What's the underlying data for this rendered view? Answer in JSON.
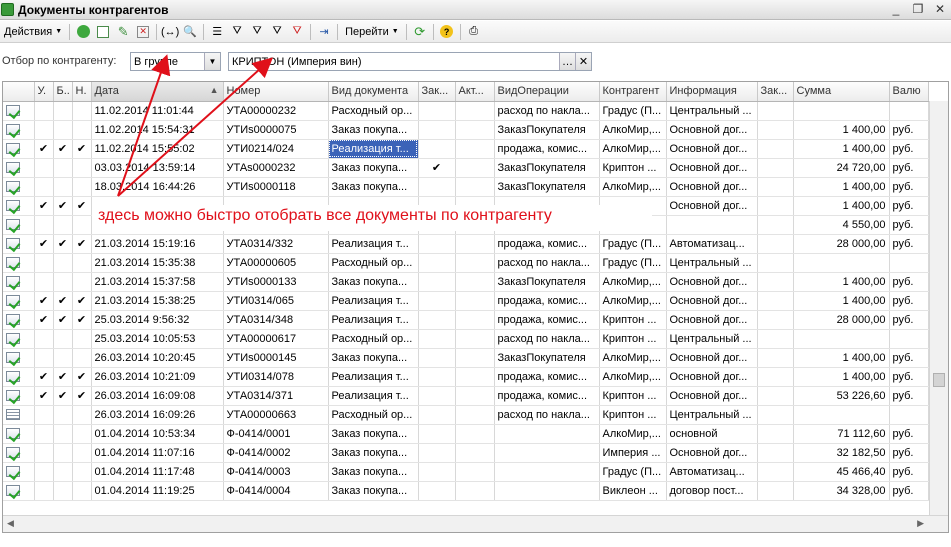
{
  "window": {
    "title": "Документы контрагентов"
  },
  "toolbar": {
    "actions_label": "Действия",
    "goto_label": "Перейти"
  },
  "filter": {
    "label": "Отбор по контрагенту:",
    "mode": "В группе",
    "value": "КРИПТОН (Империя вин)"
  },
  "annotation": "здесь можно быстро отобрать все документы по контрагенту",
  "colors": {
    "annotation": "#e0101a",
    "selection": "#3b63b8",
    "posted_check": "#27a327"
  },
  "table": {
    "columns": [
      "",
      "У.",
      "Б..",
      "Н.",
      "Дата",
      "Номер",
      "Вид документа",
      "Зак...",
      "Акт...",
      "ВидОперации",
      "Контрагент",
      "Информация",
      "Зак...",
      "Сумма",
      "Валю"
    ],
    "rows": [
      [
        "posted",
        "",
        "",
        "",
        "11.02.2014 11:01:44",
        "УТА00000232",
        "Расходный ор...",
        "",
        "",
        "расход по накла...",
        "Градус (П...",
        "Центральный ...",
        "",
        "",
        ""
      ],
      [
        "posted",
        "",
        "",
        "",
        "11.02.2014 15:54:31",
        "УТИs0000075",
        "Заказ покупа...",
        "",
        "",
        "ЗаказПокупателя",
        "АлкоМир,...",
        "Основной дог...",
        "",
        "1 400,00",
        "руб."
      ],
      [
        "posted",
        "✔",
        "✔",
        "✔",
        "11.02.2014 15:55:02",
        "УТИ0214/024",
        "Реализация т...",
        "",
        "",
        "продажа, комис...",
        "АлкоМир,...",
        "Основной дог...",
        "",
        "1 400,00",
        "руб."
      ],
      [
        "posted",
        "",
        "",
        "",
        "03.03.2014 13:59:14",
        "УТАs0000232",
        "Заказ покупа...",
        "✔",
        "",
        "ЗаказПокупателя",
        "Криптон ...",
        "Основной дог...",
        "",
        "24 720,00",
        "руб."
      ],
      [
        "posted",
        "",
        "",
        "",
        "18.03.2014 16:44:26",
        "УТИs0000118",
        "Заказ покупа...",
        "",
        "",
        "ЗаказПокупателя",
        "АлкоМир,...",
        "Основной дог...",
        "",
        "1 400,00",
        "руб."
      ],
      [
        "posted",
        "✔",
        "✔",
        "✔",
        "",
        "",
        "",
        "",
        "",
        "",
        "",
        "Основной дог...",
        "",
        "1 400,00",
        "руб."
      ],
      [
        "posted",
        "",
        "",
        "",
        "",
        "",
        "",
        "",
        "",
        "",
        "",
        "",
        "",
        "4 550,00",
        "руб."
      ],
      [
        "posted",
        "✔",
        "✔",
        "✔",
        "21.03.2014 15:19:16",
        "УТА0314/332",
        "Реализация т...",
        "",
        "",
        "продажа, комис...",
        "Градус (П...",
        "Автоматизац...",
        "",
        "28 000,00",
        "руб."
      ],
      [
        "posted",
        "",
        "",
        "",
        "21.03.2014 15:35:38",
        "УТА00000605",
        "Расходный ор...",
        "",
        "",
        "расход по накла...",
        "Градус (П...",
        "Центральный ...",
        "",
        "",
        ""
      ],
      [
        "posted",
        "",
        "",
        "",
        "21.03.2014 15:37:58",
        "УТИs0000133",
        "Заказ покупа...",
        "",
        "",
        "ЗаказПокупателя",
        "АлкоМир,...",
        "Основной дог...",
        "",
        "1 400,00",
        "руб."
      ],
      [
        "posted",
        "✔",
        "✔",
        "✔",
        "21.03.2014 15:38:25",
        "УТИ0314/065",
        "Реализация т...",
        "",
        "",
        "продажа, комис...",
        "АлкоМир,...",
        "Основной дог...",
        "",
        "1 400,00",
        "руб."
      ],
      [
        "posted",
        "✔",
        "✔",
        "✔",
        "25.03.2014 9:56:32",
        "УТА0314/348",
        "Реализация т...",
        "",
        "",
        "продажа, комис...",
        "Криптон ...",
        "Основной дог...",
        "",
        "28 000,00",
        "руб."
      ],
      [
        "posted",
        "",
        "",
        "",
        "25.03.2014 10:05:53",
        "УТА00000617",
        "Расходный ор...",
        "",
        "",
        "расход по накла...",
        "Криптон ...",
        "Центральный ...",
        "",
        "",
        ""
      ],
      [
        "posted",
        "",
        "",
        "",
        "26.03.2014 10:20:45",
        "УТИs0000145",
        "Заказ покупа...",
        "",
        "",
        "ЗаказПокупателя",
        "АлкоМир,...",
        "Основной дог...",
        "",
        "1 400,00",
        "руб."
      ],
      [
        "posted",
        "✔",
        "✔",
        "✔",
        "26.03.2014 10:21:09",
        "УТИ0314/078",
        "Реализация т...",
        "",
        "",
        "продажа, комис...",
        "АлкоМир,...",
        "Основной дог...",
        "",
        "1 400,00",
        "руб."
      ],
      [
        "posted",
        "✔",
        "✔",
        "✔",
        "26.03.2014 16:09:08",
        "УТА0314/371",
        "Реализация т...",
        "",
        "",
        "продажа, комис...",
        "Криптон ...",
        "Основной дог...",
        "",
        "53 226,60",
        "руб."
      ],
      [
        "plain",
        "",
        "",
        "",
        "26.03.2014 16:09:26",
        "УТА00000663",
        "Расходный ор...",
        "",
        "",
        "расход по накла...",
        "Криптон ...",
        "Центральный ...",
        "",
        "",
        ""
      ],
      [
        "posted",
        "",
        "",
        "",
        "01.04.2014 10:53:34",
        "Ф-0414/0001",
        "Заказ покупа...",
        "",
        "",
        "",
        "АлкоМир,...",
        "основной",
        "",
        "71 112,60",
        "руб."
      ],
      [
        "posted",
        "",
        "",
        "",
        "01.04.2014 11:07:16",
        "Ф-0414/0002",
        "Заказ покупа...",
        "",
        "",
        "",
        "Империя ...",
        "Основной дог...",
        "",
        "32 182,50",
        "руб."
      ],
      [
        "posted",
        "",
        "",
        "",
        "01.04.2014 11:17:48",
        "Ф-0414/0003",
        "Заказ покупа...",
        "",
        "",
        "",
        "Градус (П...",
        "Автоматизац...",
        "",
        "45 466,40",
        "руб."
      ],
      [
        "posted",
        "",
        "",
        "",
        "01.04.2014 11:19:25",
        "Ф-0414/0004",
        "Заказ покупа...",
        "",
        "",
        "",
        "Виклеон ...",
        "договор пост...",
        "",
        "34 328,00",
        "руб."
      ]
    ]
  }
}
